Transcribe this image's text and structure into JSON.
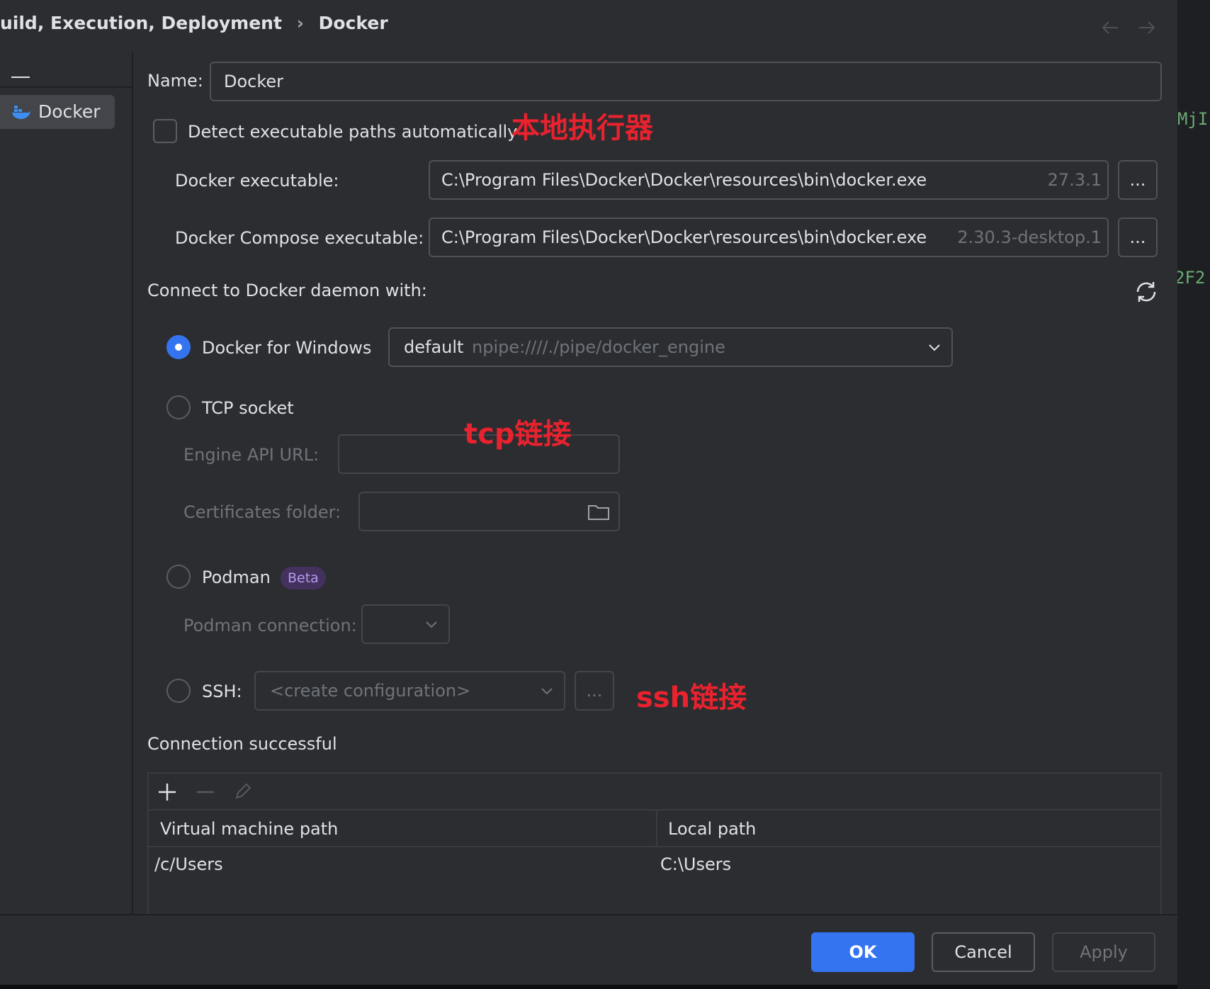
{
  "breadcrumb": {
    "parent": "uild, Execution, Deployment",
    "separator": "›",
    "current": "Docker"
  },
  "sidebar": {
    "item_label": "Docker"
  },
  "form": {
    "name_label": "Name:",
    "name_value": "Docker",
    "detect_label": "Detect executable paths automatically",
    "docker_exe_label": "Docker executable:",
    "docker_exe_value": "C:\\Program Files\\Docker\\Docker\\resources\\bin\\docker.exe",
    "docker_exe_version": "27.3.1",
    "compose_exe_label": "Docker Compose executable:",
    "compose_exe_value": "C:\\Program Files\\Docker\\Docker\\resources\\bin\\docker.exe",
    "compose_exe_version": "2.30.3-desktop.1",
    "browse_label": "...",
    "connect_label": "Connect to Docker daemon with:",
    "docker_windows_label": "Docker for Windows",
    "context_name": "default",
    "context_path": "npipe:////./pipe/docker_engine",
    "tcp_label": "TCP socket",
    "engine_api_label": "Engine API URL:",
    "certs_label": "Certificates folder:",
    "podman_label": "Podman",
    "beta_badge": "Beta",
    "podman_conn_label": "Podman connection:",
    "ssh_label": "SSH:",
    "ssh_placeholder": "<create configuration>",
    "status": "Connection successful"
  },
  "mappings": {
    "columns": [
      "Virtual machine path",
      "Local path"
    ],
    "rows": [
      {
        "vm": "/c/Users",
        "local": "C:\\Users"
      }
    ]
  },
  "footer": {
    "ok": "OK",
    "cancel": "Cancel",
    "apply": "Apply"
  },
  "annotations": {
    "local_executor": "本地执行器",
    "tcp": "tcp链接",
    "ssh": "ssh链接"
  },
  "editor_fragments": [
    "MjI",
    "2F2"
  ],
  "colors": {
    "accent": "#3574f0",
    "annotation": "#e8222e",
    "beta_bg": "#43325e",
    "beta_text": "#b89af0",
    "code_green": "#6aab73"
  }
}
